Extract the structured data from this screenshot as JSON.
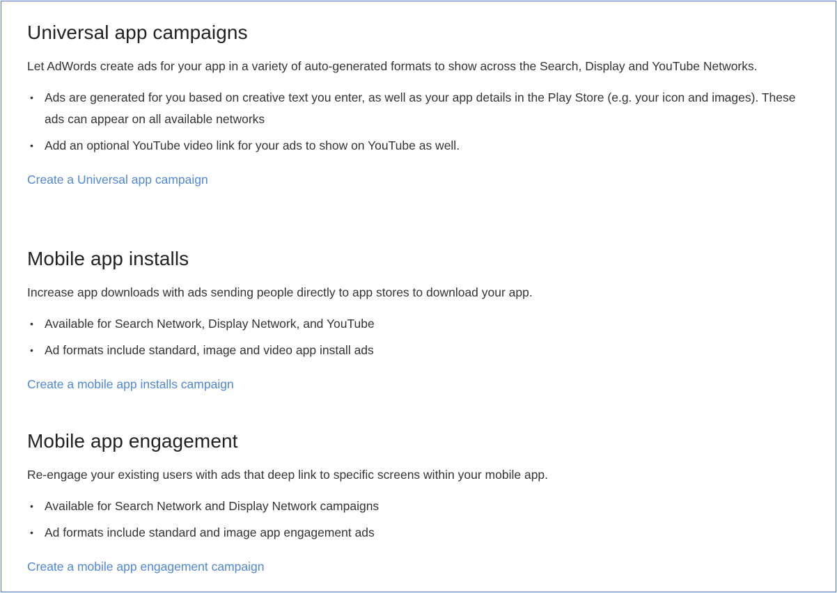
{
  "sections": [
    {
      "title": "Universal app campaigns",
      "description": "Let AdWords create ads for your app in a variety of auto-generated formats to show across the Search, Display and YouTube Networks.",
      "bullets": [
        "Ads are generated for you based on creative text you enter, as well as your app details in the Play Store (e.g. your icon and images). These ads can appear on all available networks",
        "Add an optional YouTube video link for your ads to show on YouTube as well."
      ],
      "link": "Create a Universal app campaign"
    },
    {
      "title": "Mobile app installs",
      "description": "Increase app downloads with ads sending people directly to app stores to download your app.",
      "bullets": [
        "Available for Search Network, Display Network, and YouTube",
        "Ad formats include standard, image and video app install ads"
      ],
      "link": "Create a mobile app installs campaign"
    },
    {
      "title": "Mobile app engagement",
      "description": "Re-engage your existing users with ads that deep link to specific screens within your mobile app.",
      "bullets": [
        "Available for Search Network and Display Network campaigns",
        "Ad formats include standard and image app engagement ads"
      ],
      "link": "Create a mobile app engagement campaign"
    }
  ],
  "colors": {
    "link": "#4f86d6",
    "border": "#4a7ac0",
    "text": "#333333",
    "heading": "#202124"
  }
}
